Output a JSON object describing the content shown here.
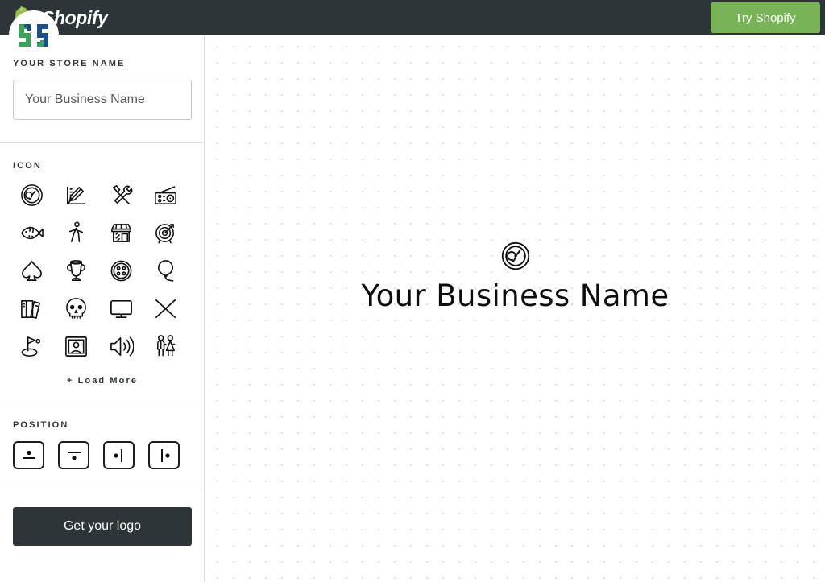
{
  "header": {
    "brand_name": "Shopify",
    "brand_icon": "shopify-bag-icon",
    "cta_label": "Try Shopify",
    "bg_color": "#2d3538",
    "cta_color": "#78b457"
  },
  "badge": {
    "icon": "interlocking-s-badge-logo",
    "green": "#3aa355",
    "blue": "#1b4f8a"
  },
  "sidebar": {
    "store": {
      "label": "Your Store Name",
      "input_value": "",
      "placeholder": "Your Business Name"
    },
    "icon_section": {
      "label": "Icon",
      "load_more_label": "+ Load More",
      "icons": [
        {
          "name": "radar-target-icon"
        },
        {
          "name": "ruler-pencil-icon"
        },
        {
          "name": "hammer-wrench-icon"
        },
        {
          "name": "radio-icon"
        },
        {
          "name": "fish-icon"
        },
        {
          "name": "walking-person-icon"
        },
        {
          "name": "storefront-icon"
        },
        {
          "name": "target-arrow-icon"
        },
        {
          "name": "spade-icon"
        },
        {
          "name": "trophy-icon"
        },
        {
          "name": "sewing-button-icon"
        },
        {
          "name": "balloon-icon"
        },
        {
          "name": "books-icon"
        },
        {
          "name": "skull-icon"
        },
        {
          "name": "monitor-icon"
        },
        {
          "name": "cross-x-icon"
        },
        {
          "name": "golf-flag-icon"
        },
        {
          "name": "photo-frame-icon"
        },
        {
          "name": "speaker-icon"
        },
        {
          "name": "couple-icon"
        }
      ]
    },
    "position_section": {
      "label": "Position",
      "options": [
        {
          "name": "position-icon-above-text",
          "selected": true
        },
        {
          "name": "position-icon-below-text",
          "selected": false
        },
        {
          "name": "position-icon-left-of-text",
          "selected": false
        },
        {
          "name": "position-icon-right-of-text",
          "selected": false
        }
      ]
    },
    "cta_label": "Get your logo"
  },
  "canvas": {
    "preview_icon": "radar-target-icon",
    "preview_text": "Your Business Name",
    "grid": "dotted"
  }
}
